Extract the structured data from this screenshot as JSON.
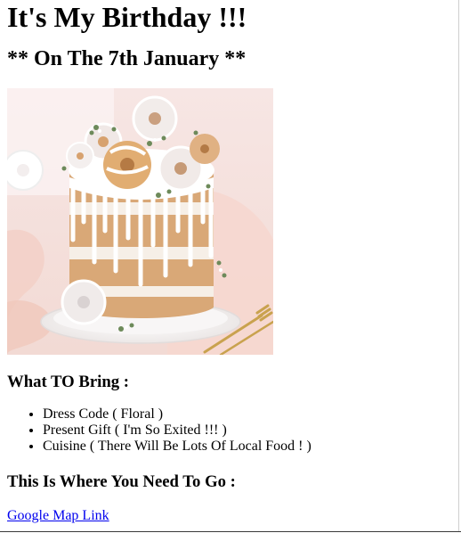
{
  "page": {
    "title": "It's My Birthday !!!",
    "date_heading": "** On The 7th January **",
    "image_alt": "Birthday cake topped with donuts"
  },
  "bring": {
    "heading": "What TO Bring :",
    "items": [
      "Dress Code ( Floral )",
      "Present Gift ( I'm So Exited !!! )",
      "Cuisine ( There Will Be Lots Of Local Food ! )"
    ]
  },
  "location": {
    "heading": "This Is Where You Need To Go :",
    "link_label": "Google Map Link"
  },
  "colors": {
    "link": "#0000ee",
    "text": "#000000",
    "background": "#ffffff"
  },
  "icons": {
    "list_bullet": "bullet-disc"
  }
}
